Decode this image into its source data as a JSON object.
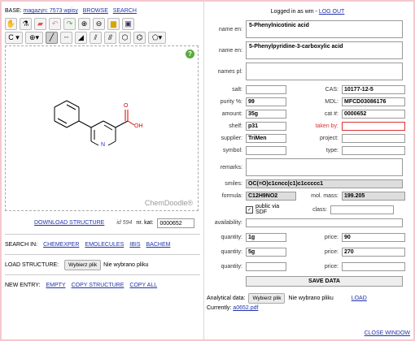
{
  "base": {
    "label": "BASE:",
    "magazyn": "magazyn: 7573 wpisy",
    "browse": "BROWSE",
    "search": "SEARCH"
  },
  "toolbar": {
    "icons": [
      "hand-icon",
      "flask-icon",
      "eraser-icon",
      "undo-icon",
      "redo-icon",
      "zoom-in-icon",
      "zoom-out-icon",
      "open-folder-icon",
      "save-icon"
    ],
    "icons2": [
      "atom-dropdown",
      "charge-dropdown",
      "single-bond-icon",
      "dashed-bond-icon",
      "wedge-bond-icon",
      "double-bond-icon",
      "triple-bond-icon",
      "hexagon-icon",
      "benzene-icon",
      "pentagon-dropdown"
    ]
  },
  "canvas": {
    "brand": "ChemDoodle",
    "help": "?",
    "atoms": {
      "o": "O",
      "oh": "OH",
      "n": "N"
    }
  },
  "download": {
    "link": "DOWNLOAD STRUCTURE",
    "id": "id 594",
    "nr_kat_label": "nr. kat:",
    "nr_kat": "0000652"
  },
  "search_in": {
    "label": "SEARCH IN:",
    "links": [
      "CHEMEXPER",
      "EMOLECULES",
      "IBIS",
      "BACHEM"
    ]
  },
  "load": {
    "label": "LOAD STRUCTURE:",
    "button": "Wybierz plik",
    "status": "Nie wybrano pliku"
  },
  "new_entry": {
    "label": "NEW ENTRY:",
    "links": [
      "EMPTY",
      "COPY STRUCTURE",
      "COPY ALL"
    ]
  },
  "login": {
    "text": "Logged in as wm -",
    "logout": "LOG OUT"
  },
  "form": {
    "name_en_label": "name en:",
    "name_en_1": "5-Phenylnicotinic acid",
    "name_en_2": "5-Phenylpyridine-3-carboxylic acid",
    "name_pl_label": "names pl:",
    "name_pl": "",
    "salt_label": "salt:",
    "salt": "",
    "cas_label": "CAS:",
    "cas": "10177-12-5",
    "purity_label": "purity %:",
    "purity": "99",
    "mdl_label": "MDL:",
    "mdl": "MFCD03086176",
    "amount_label": "amount:",
    "amount": "35g",
    "cat_label": "cat #:",
    "cat": "0000652",
    "shelf_label": "shelf:",
    "shelf": "p31",
    "taken_label": "taken by:",
    "taken": "",
    "supplier_label": "supplier:",
    "supplier": "TriMen",
    "project_label": "project:",
    "project": "",
    "symbol_label": "symbol:",
    "symbol": "",
    "type_label": "type:",
    "type": "",
    "remarks_label": "remarks:",
    "remarks": "",
    "smiles_label": "smiles:",
    "smiles": "OC(=O)c1cncc(c1)c1ccccc1",
    "formula_label": "formula:",
    "formula": "C12H9NO2",
    "mass_label": "mol. mass:",
    "mass": "199.205",
    "public_label": "public via SDF",
    "class_label": "class:",
    "class": "",
    "availability_label": "availability:",
    "availability": "",
    "quantity_label": "quantity:",
    "price_label": "price:",
    "q1": "1g",
    "p1": "90",
    "q2": "5g",
    "p2": "270",
    "q3": "",
    "p3": ""
  },
  "save": "SAVE DATA",
  "analytical": {
    "label": "Analytical data:",
    "button": "Wybierz plik",
    "status": "Nie wybrano pliku",
    "load": "LOAD",
    "currently_label": "Currently:",
    "currently": "a0652.pdf"
  },
  "close": "CLOSE WINDOW"
}
